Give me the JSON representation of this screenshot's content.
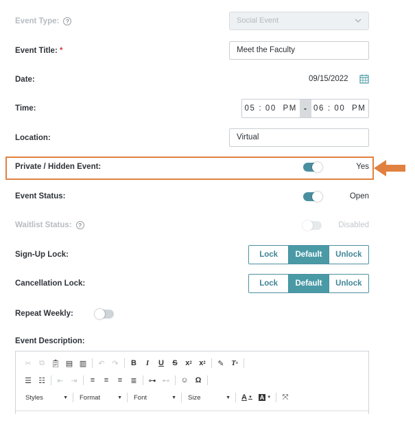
{
  "form": {
    "event_type": {
      "label": "Event Type:",
      "value": "Social Event"
    },
    "event_title": {
      "label": "Event Title:",
      "required_mark": "*",
      "value": "Meet the Faculty"
    },
    "date": {
      "label": "Date:",
      "value": "09/15/2022"
    },
    "time": {
      "label": "Time:",
      "start": "05 : 00  PM",
      "separator": "-",
      "end": "06 : 00  PM"
    },
    "location": {
      "label": "Location:",
      "value": "Virtual"
    },
    "private_hidden": {
      "label": "Private / Hidden Event:",
      "state": "Yes",
      "on": true
    },
    "event_status": {
      "label": "Event Status:",
      "state": "Open",
      "on": true
    },
    "waitlist_status": {
      "label": "Waitlist Status:",
      "state": "Disabled",
      "on": false,
      "disabled": true
    },
    "signup_lock": {
      "label": "Sign-Up Lock:",
      "options": [
        "Lock",
        "Default",
        "Unlock"
      ],
      "selected": "Default"
    },
    "cancellation_lock": {
      "label": "Cancellation Lock:",
      "options": [
        "Lock",
        "Default",
        "Unlock"
      ],
      "selected": "Default"
    },
    "repeat_weekly": {
      "label": "Repeat Weekly:",
      "on": false
    },
    "event_description": {
      "label": "Event Description:"
    }
  },
  "editor_toolbar": {
    "styles": "Styles",
    "format": "Format",
    "font": "Font",
    "size": "Size",
    "icons": [
      "cut-icon",
      "copy-icon",
      "paste-icon",
      "paste-text-icon",
      "paste-word-icon",
      "undo-icon",
      "redo-icon",
      "bold-icon",
      "italic-icon",
      "underline-icon",
      "strikethrough-icon",
      "subscript-icon",
      "superscript-icon",
      "copy-formatting-icon",
      "remove-format-icon",
      "numbered-list-icon",
      "bulleted-list-icon",
      "outdent-icon",
      "indent-icon",
      "align-left-icon",
      "align-center-icon",
      "align-right-icon",
      "justify-icon",
      "link-icon",
      "unlink-icon",
      "smiley-icon",
      "special-character-icon",
      "text-color-icon",
      "background-color-icon",
      "maximize-icon"
    ]
  },
  "colors": {
    "accent": "#4a9aa6",
    "highlight": "#e0813f",
    "required": "#d23b3b"
  }
}
